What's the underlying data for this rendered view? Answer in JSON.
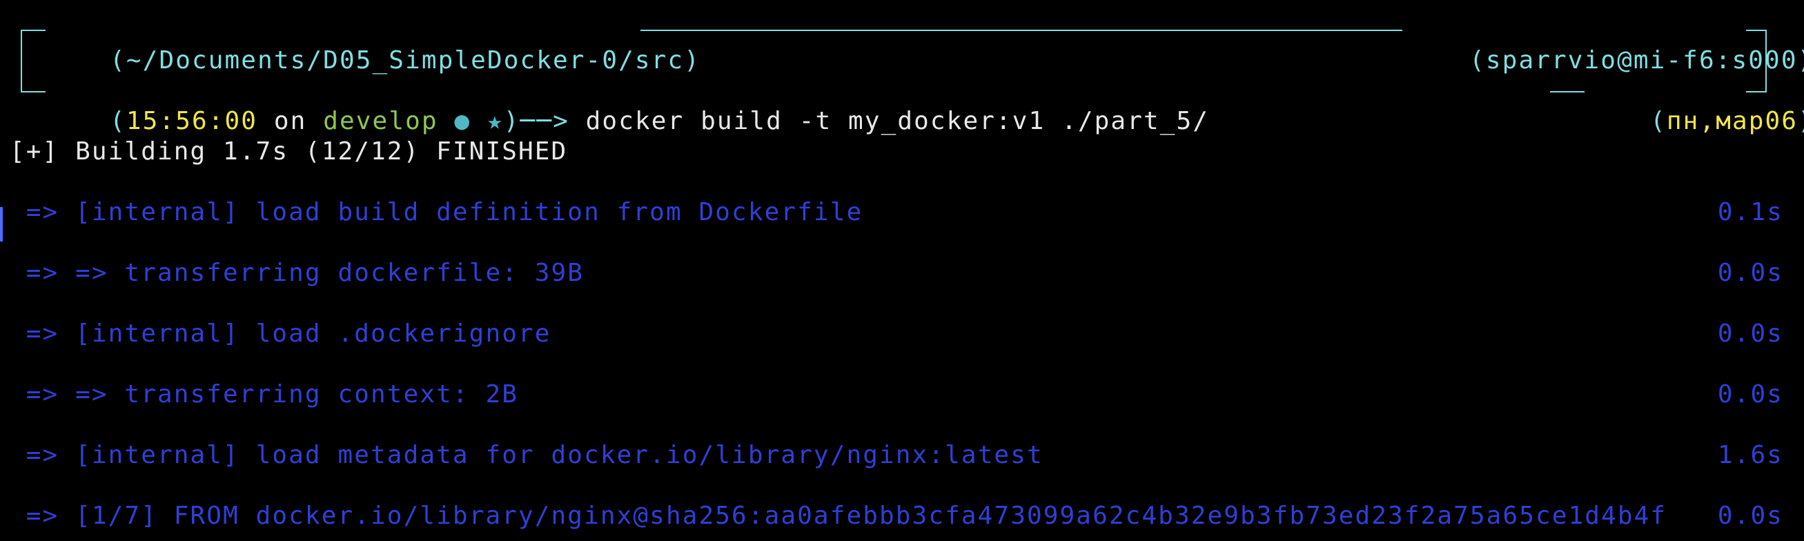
{
  "prompt": {
    "path": "~/Documents/D05_SimpleDocker-0/src",
    "user_host": "sparrvio@mi-f6:s000",
    "time": "15:56:00",
    "on_word": "on",
    "branch": "develop",
    "status_dot": "●",
    "status_star": "★",
    "arrow": "──>",
    "command": "docker build -t my_docker:v1 ./part_5/",
    "date": "пн,мар06"
  },
  "build": {
    "header": "[+] Building 1.7s (12/12) FINISHED",
    "steps": [
      {
        "text": " => [internal] load build definition from Dockerfile",
        "time": "0.1s"
      },
      {
        "text": " => => transferring dockerfile: 39B",
        "time": "0.0s"
      },
      {
        "text": " => [internal] load .dockerignore",
        "time": "0.0s"
      },
      {
        "text": " => => transferring context: 2B",
        "time": "0.0s"
      },
      {
        "text": " => [internal] load metadata for docker.io/library/nginx:latest",
        "time": "1.6s"
      },
      {
        "text": " => [1/7] FROM docker.io/library/nginx@sha256:aa0afebbb3cfa473099a62c4b32e9b3fb73ed23f2a75a65ce1d4b4f",
        "time": "0.0s"
      }
    ]
  },
  "colors": {
    "background": "#000000",
    "frame": "#7fdfe2",
    "time": "#f2e64a",
    "branch": "#8dc850",
    "build_steps": "#2f3fd6"
  }
}
